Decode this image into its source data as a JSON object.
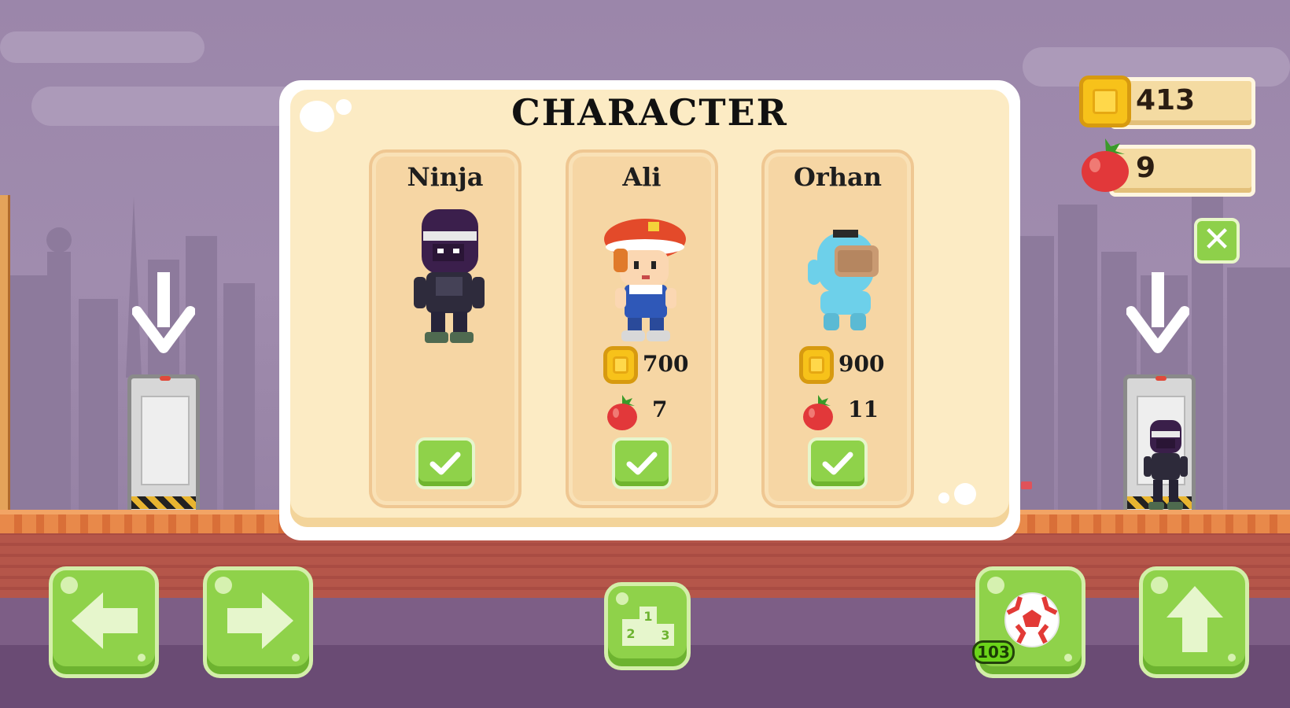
{
  "title": "CHARACTER",
  "hud": {
    "coins": "413",
    "apples": "9"
  },
  "characters": [
    {
      "name": "Ninja",
      "coin_price": "",
      "apple_price": "",
      "icon": "ninja-character"
    },
    {
      "name": "Ali",
      "coin_price": "700",
      "apple_price": "7",
      "icon": "ali-character"
    },
    {
      "name": "Orhan",
      "coin_price": "900",
      "apple_price": "11",
      "icon": "orhan-character"
    }
  ],
  "controls": {
    "left_icon": "arrow-left-icon",
    "right_icon": "arrow-right-icon",
    "leaderboard_icon": "podium-icon",
    "ball_icon": "soccer-ball-icon",
    "ball_count": "103",
    "jump_icon": "arrow-up-icon"
  },
  "podium_labels": [
    "1",
    "2",
    "3"
  ],
  "colors": {
    "button_green": "#8fd24a",
    "panel_cream": "#fcebc4",
    "card_tan": "#f6d6a4",
    "coin_gold": "#f7c21a",
    "sky_purple": "#9b86aa"
  }
}
